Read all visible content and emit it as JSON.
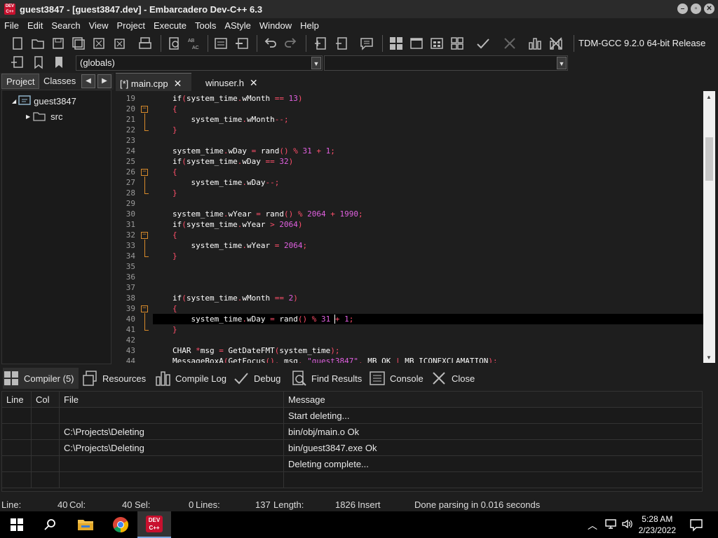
{
  "window": {
    "title": "guest3847 - [guest3847.dev] - Embarcadero Dev-C++ 6.3",
    "logo_text": "DEV C++"
  },
  "menu": [
    "File",
    "Edit",
    "Search",
    "View",
    "Project",
    "Execute",
    "Tools",
    "AStyle",
    "Window",
    "Help"
  ],
  "toolbar": {
    "compiler": "TDM-GCC 9.2.0 64-bit Release",
    "scope_combo": "(globals)",
    "func_combo": ""
  },
  "left_panel": {
    "tabs": [
      "Project",
      "Classes"
    ],
    "tree": [
      {
        "label": "guest3847",
        "icon": "project-icon"
      },
      {
        "label": "src",
        "icon": "folder-icon"
      }
    ]
  },
  "editor": {
    "tabs": [
      {
        "label": "[*] main.cpp",
        "active": true
      },
      {
        "label": "winuser.h",
        "active": false
      }
    ],
    "lines": [
      {
        "n": "19",
        "tokens": [
          [
            "kw",
            "if"
          ],
          [
            "sym",
            "("
          ],
          [
            "kw",
            "system_time"
          ],
          [
            "sym",
            "."
          ],
          [
            "kw",
            "wMonth "
          ],
          [
            "sym",
            "== "
          ],
          [
            "num",
            "13"
          ],
          [
            "sym",
            ")"
          ]
        ]
      },
      {
        "n": "20",
        "tokens": [
          [
            "sym",
            "{"
          ]
        ]
      },
      {
        "n": "21",
        "tokens": [
          [
            "kw",
            "    system_time"
          ],
          [
            "sym",
            "."
          ],
          [
            "kw",
            "wMonth"
          ],
          [
            "sym",
            "--;"
          ]
        ]
      },
      {
        "n": "22",
        "tokens": [
          [
            "sym",
            "}"
          ]
        ]
      },
      {
        "n": "23",
        "tokens": []
      },
      {
        "n": "24",
        "tokens": [
          [
            "kw",
            "system_time"
          ],
          [
            "sym",
            "."
          ],
          [
            "kw",
            "wDay "
          ],
          [
            "sym",
            "= "
          ],
          [
            "kw",
            "rand"
          ],
          [
            "sym",
            "() % "
          ],
          [
            "num",
            "31"
          ],
          [
            "sym",
            " + "
          ],
          [
            "num",
            "1"
          ],
          [
            "sym",
            ";"
          ]
        ]
      },
      {
        "n": "25",
        "tokens": [
          [
            "kw",
            "if"
          ],
          [
            "sym",
            "("
          ],
          [
            "kw",
            "system_time"
          ],
          [
            "sym",
            "."
          ],
          [
            "kw",
            "wDay "
          ],
          [
            "sym",
            "== "
          ],
          [
            "num",
            "32"
          ],
          [
            "sym",
            ")"
          ]
        ]
      },
      {
        "n": "26",
        "tokens": [
          [
            "sym",
            "{"
          ]
        ]
      },
      {
        "n": "27",
        "tokens": [
          [
            "kw",
            "    system_time"
          ],
          [
            "sym",
            "."
          ],
          [
            "kw",
            "wDay"
          ],
          [
            "sym",
            "--;"
          ]
        ]
      },
      {
        "n": "28",
        "tokens": [
          [
            "sym",
            "}"
          ]
        ]
      },
      {
        "n": "29",
        "tokens": []
      },
      {
        "n": "30",
        "tokens": [
          [
            "kw",
            "system_time"
          ],
          [
            "sym",
            "."
          ],
          [
            "kw",
            "wYear "
          ],
          [
            "sym",
            "= "
          ],
          [
            "kw",
            "rand"
          ],
          [
            "sym",
            "() % "
          ],
          [
            "num",
            "2064"
          ],
          [
            "sym",
            " + "
          ],
          [
            "num",
            "1990"
          ],
          [
            "sym",
            ";"
          ]
        ]
      },
      {
        "n": "31",
        "tokens": [
          [
            "kw",
            "if"
          ],
          [
            "sym",
            "("
          ],
          [
            "kw",
            "system_time"
          ],
          [
            "sym",
            "."
          ],
          [
            "kw",
            "wYear "
          ],
          [
            "sym",
            "> "
          ],
          [
            "num",
            "2064"
          ],
          [
            "sym",
            ")"
          ]
        ]
      },
      {
        "n": "32",
        "tokens": [
          [
            "sym",
            "{"
          ]
        ]
      },
      {
        "n": "33",
        "tokens": [
          [
            "kw",
            "    system_time"
          ],
          [
            "sym",
            "."
          ],
          [
            "kw",
            "wYear "
          ],
          [
            "sym",
            "= "
          ],
          [
            "num",
            "2064"
          ],
          [
            "sym",
            ";"
          ]
        ]
      },
      {
        "n": "34",
        "tokens": [
          [
            "sym",
            "}"
          ]
        ]
      },
      {
        "n": "35",
        "tokens": []
      },
      {
        "n": "36",
        "tokens": []
      },
      {
        "n": "37",
        "tokens": []
      },
      {
        "n": "38",
        "tokens": [
          [
            "kw",
            "if"
          ],
          [
            "sym",
            "("
          ],
          [
            "kw",
            "system_time"
          ],
          [
            "sym",
            "."
          ],
          [
            "kw",
            "wMonth "
          ],
          [
            "sym",
            "== "
          ],
          [
            "num",
            "2"
          ],
          [
            "sym",
            ")"
          ]
        ]
      },
      {
        "n": "39",
        "tokens": [
          [
            "sym",
            "{"
          ]
        ]
      },
      {
        "n": "40",
        "tokens": [
          [
            "kw",
            "    system_time"
          ],
          [
            "sym",
            "."
          ],
          [
            "kw",
            "wDay "
          ],
          [
            "sym",
            "= "
          ],
          [
            "kw",
            "rand"
          ],
          [
            "sym",
            "() % "
          ],
          [
            "num",
            "31"
          ],
          [
            "sym",
            " + "
          ],
          [
            "num",
            "1"
          ],
          [
            "sym",
            ";"
          ]
        ]
      },
      {
        "n": "41",
        "tokens": [
          [
            "sym",
            "}"
          ]
        ]
      },
      {
        "n": "42",
        "tokens": []
      },
      {
        "n": "43",
        "tokens": [
          [
            "kw",
            "CHAR "
          ],
          [
            "sym",
            "*"
          ],
          [
            "kw",
            "msg "
          ],
          [
            "sym",
            "= "
          ],
          [
            "kw",
            "GetDateFMT"
          ],
          [
            "sym",
            "("
          ],
          [
            "kw",
            "system_time"
          ],
          [
            "sym",
            ");"
          ]
        ]
      },
      {
        "n": "44",
        "tokens": [
          [
            "kw",
            "MessageBoxA"
          ],
          [
            "sym",
            "("
          ],
          [
            "kw",
            "GetFocus"
          ],
          [
            "sym",
            "(), "
          ],
          [
            "kw",
            "msg"
          ],
          [
            "sym",
            ", "
          ],
          [
            "str",
            "\"guest3847\""
          ],
          [
            "sym",
            ", "
          ],
          [
            "kw",
            "MB_OK "
          ],
          [
            "sym",
            "| "
          ],
          [
            "kw",
            "MB_ICONEXCLAMATION"
          ],
          [
            "sym",
            ");"
          ]
        ]
      }
    ]
  },
  "bottom_tabs": [
    {
      "label": "Compiler (5)",
      "icon": "compiler-icon"
    },
    {
      "label": "Resources",
      "icon": "resources-icon"
    },
    {
      "label": "Compile Log",
      "icon": "compile-log-icon"
    },
    {
      "label": "Debug",
      "icon": "debug-icon"
    },
    {
      "label": "Find Results",
      "icon": "find-results-icon"
    },
    {
      "label": "Console",
      "icon": "console-icon"
    },
    {
      "label": "Close",
      "icon": "close-icon"
    }
  ],
  "compiler_table": {
    "headers": [
      "Line",
      "Col",
      "File",
      "Message"
    ],
    "rows": [
      [
        "",
        "",
        "",
        "Start deleting..."
      ],
      [
        "",
        "",
        "C:\\Projects\\Deleting",
        "bin/obj/main.o Ok"
      ],
      [
        "",
        "",
        "C:\\Projects\\Deleting",
        "bin/guest3847.exe Ok"
      ],
      [
        "",
        "",
        "",
        "Deleting complete..."
      ],
      [
        "",
        "",
        "",
        ""
      ]
    ]
  },
  "status": {
    "line_label": "Line:",
    "line_value": "40",
    "col_label": "Col:",
    "col_value": "40",
    "sel_label": "Sel:",
    "sel_value": "0",
    "lines_label": "Lines:",
    "lines_value": "137",
    "length_label": "Length:",
    "length_value": "1826",
    "mode": "Insert",
    "message": "Done parsing in 0.016 seconds"
  },
  "taskbar": {
    "time": "5:28 AM",
    "date": "2/23/2022"
  },
  "colors": {
    "accent": "#c8102e",
    "fold": "#d98b2b",
    "symbol": "#ff4f6a",
    "number": "#e060e0"
  }
}
